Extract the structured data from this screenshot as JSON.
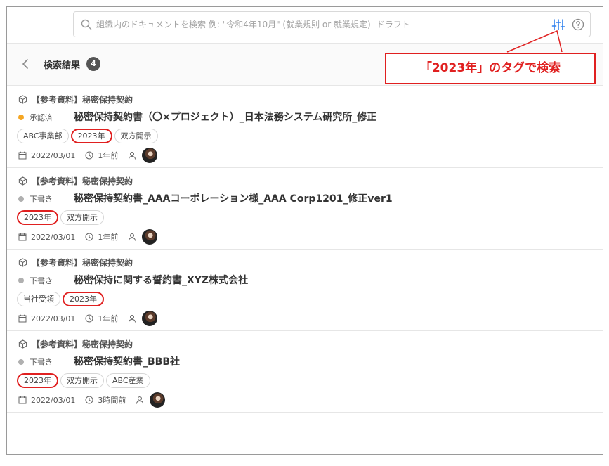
{
  "search": {
    "placeholder": "組織内のドキュメントを検索 例: \"令和4年10月\" (就業規則 or 就業規定) -ドラフト"
  },
  "header": {
    "title": "検索結果",
    "count": "4"
  },
  "callout": {
    "text": "「2023年」のタグで検索"
  },
  "colors": {
    "accent_red": "#e02020",
    "approved_dot": "#f5a623",
    "draft_dot": "#b0b0b0",
    "filter_icon": "#2f80ed"
  },
  "results": [
    {
      "category": "【参考資料】秘密保持契約",
      "status": "承認済",
      "status_color": "#f5a623",
      "title": "秘密保持契約書（〇×プロジェクト）_日本法務システム研究所_修正",
      "tags": [
        "ABC事業部",
        "2023年",
        "双方開示"
      ],
      "highlighted_tag": "2023年",
      "date": "2022/03/01",
      "relative": "1年前"
    },
    {
      "category": "【参考資料】秘密保持契約",
      "status": "下書き",
      "status_color": "#b0b0b0",
      "title": "秘密保持契約書_AAAコーポレーション様_AAA Corp1201_修正ver1",
      "tags": [
        "2023年",
        "双方開示"
      ],
      "highlighted_tag": "2023年",
      "date": "2022/03/01",
      "relative": "1年前"
    },
    {
      "category": "【参考資料】秘密保持契約",
      "status": "下書き",
      "status_color": "#b0b0b0",
      "title": "秘密保持に関する誓約書_XYZ株式会社",
      "tags": [
        "当社受領",
        "2023年"
      ],
      "highlighted_tag": "2023年",
      "date": "2022/03/01",
      "relative": "1年前"
    },
    {
      "category": "【参考資料】秘密保持契約",
      "status": "下書き",
      "status_color": "#b0b0b0",
      "title": "秘密保持契約書_BBB社",
      "tags": [
        "2023年",
        "双方開示",
        "ABC産業"
      ],
      "highlighted_tag": "2023年",
      "date": "2022/03/01",
      "relative": "3時間前"
    }
  ]
}
